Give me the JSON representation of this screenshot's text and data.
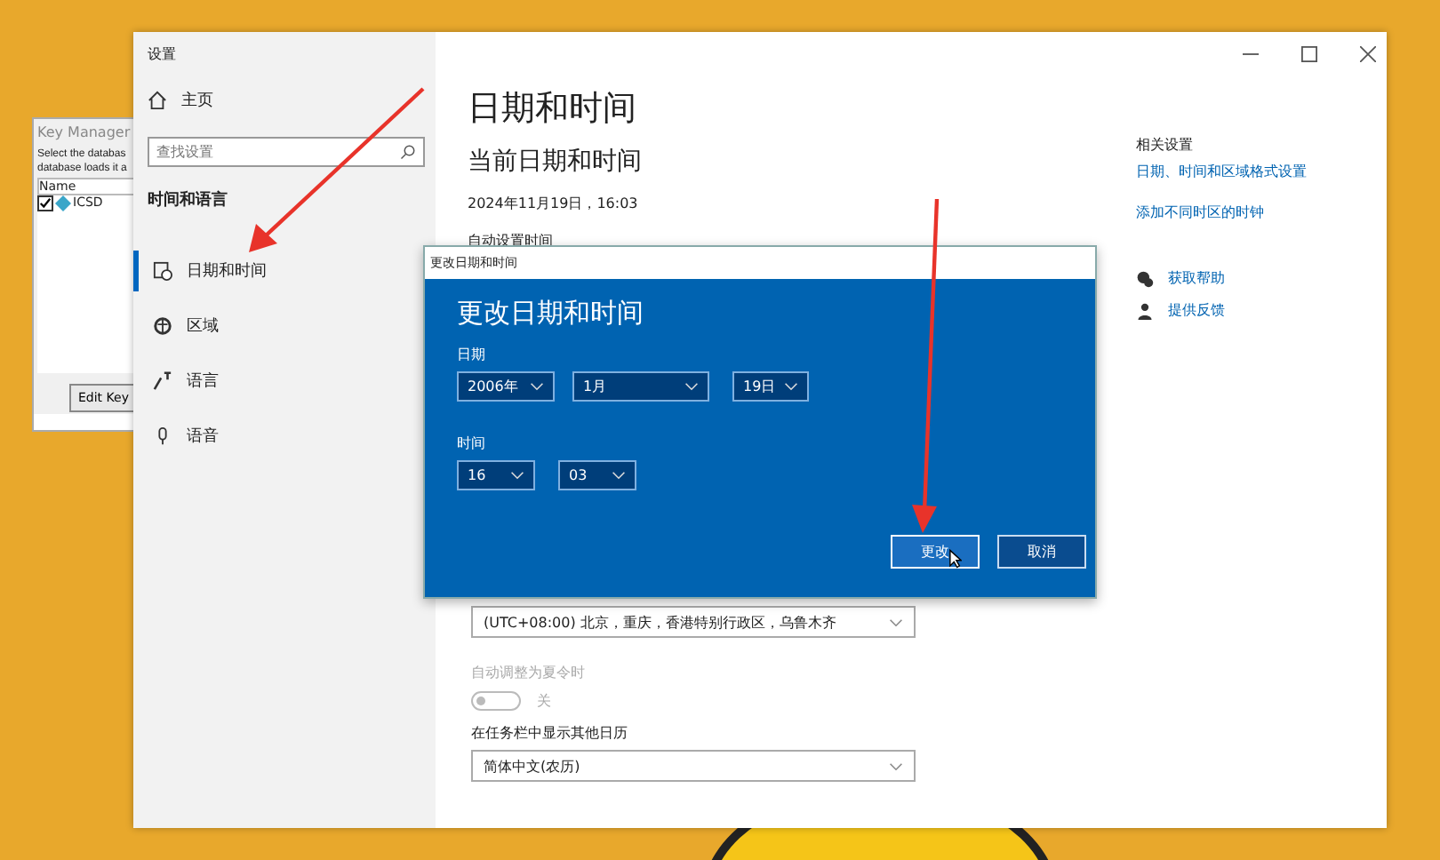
{
  "background_app": {
    "title": "Key Manager",
    "description_lines": [
      "Select the databas",
      "database loads it a"
    ],
    "column": "Name",
    "rows": [
      {
        "label": "ICSD",
        "checked": true
      }
    ],
    "button": "Edit Key"
  },
  "window": {
    "title": "设置"
  },
  "sidebar": {
    "home": "主页",
    "search": {
      "placeholder": "查找设置"
    },
    "section": "时间和语言",
    "items": [
      {
        "label": "日期和时间",
        "selected": true
      },
      {
        "label": "区域",
        "selected": false
      },
      {
        "label": "语言",
        "selected": false
      },
      {
        "label": "语音",
        "selected": false
      }
    ]
  },
  "main": {
    "title": "日期和时间",
    "subtitle": "当前日期和时间",
    "current": "2024年11月19日，16:03",
    "auto_time_label": "自动设置时间",
    "timezone": "(UTC+08:00) 北京，重庆，香港特别行政区，乌鲁木齐",
    "dst": {
      "label": "自动调整为夏令时",
      "on": false,
      "disabled": true,
      "state_text": "关"
    },
    "calendar": {
      "label": "在任务栏中显示其他日历",
      "value": "简体中文(农历)"
    }
  },
  "related": {
    "title": "相关设置",
    "links": [
      "日期、时间和区域格式设置",
      "添加不同时区的时钟"
    ],
    "help": [
      "获取帮助",
      "提供反馈"
    ]
  },
  "dialog": {
    "title": "更改日期和时间",
    "heading": "更改日期和时间",
    "date_label": "日期",
    "date_fields": [
      "2006年",
      "1月",
      "19日"
    ],
    "time_label": "时间",
    "time_fields": [
      "16",
      "03"
    ],
    "buttons": [
      {
        "label": "更改",
        "selected": true
      },
      {
        "label": "取消",
        "selected": false
      }
    ]
  }
}
